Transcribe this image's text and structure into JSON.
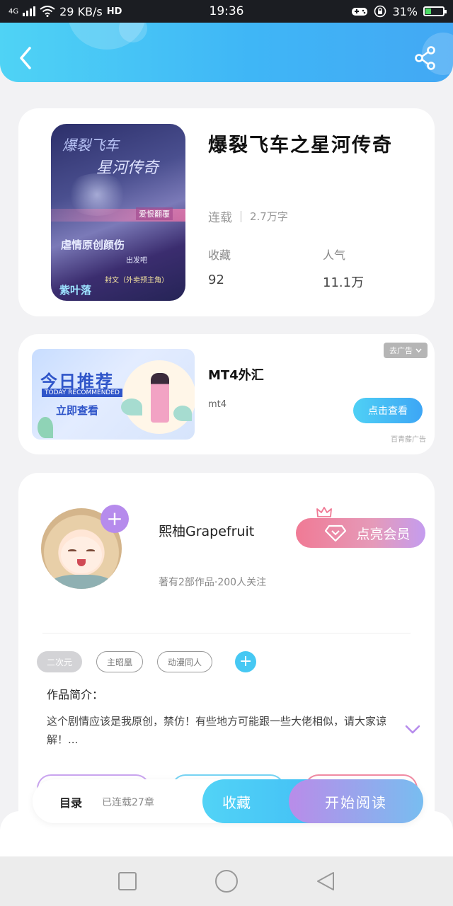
{
  "status_bar": {
    "network": "4G",
    "speed": "29 KB/s",
    "hd": "HD",
    "time": "19:36",
    "battery": "31%"
  },
  "book": {
    "title": "爆裂飞车之星河传奇",
    "status": "连载",
    "words": "2.7万字",
    "favorites_label": "收藏",
    "favorites_value": "92",
    "popularity_label": "人气",
    "popularity_value": "11.1万",
    "cover": {
      "line1": "爆裂飞车",
      "line2": "星河传奇",
      "tag": "爱恨翻覆",
      "line3": "虐情原创颜伤",
      "line4": "出发吧",
      "line5": "封文（外卖预主角）",
      "author_mark": "紫叶落"
    }
  },
  "ad": {
    "image_title": "今日推荐",
    "image_subtitle": "TODAY RECOMMENDED",
    "image_cta": "立即查看",
    "title": "MT4外汇",
    "desc": "mt4",
    "close_label": "去广告",
    "button_label": "点击查看",
    "source": "百青藤广告"
  },
  "author": {
    "name": "熙柚Grapefruit",
    "info": "著有2部作品·200人关注",
    "vip_label": "点亮会员",
    "follow_symbol": "+"
  },
  "tags": [
    {
      "label": "二次元",
      "style": "filled"
    },
    {
      "label": "主昭凰",
      "style": "outline"
    },
    {
      "label": "动漫同人",
      "style": "outline"
    }
  ],
  "tag_add_symbol": "+",
  "intro": {
    "label": "作品简介：",
    "text": "这个剧情应该是我原创，禁仿！有些地方可能跟一些大佬相似，请大家谅解！..."
  },
  "bottom_bar": {
    "toc_label": "目录",
    "toc_status": "已连载27章",
    "collect_label": "收藏",
    "read_label": "开始阅读"
  },
  "colors": {
    "header_start": "#4fd3f5",
    "header_end": "#43a8f4",
    "accent_purple": "#b68bec",
    "vip_pink": "#f07a95",
    "tag_add_blue": "#46c8f3"
  },
  "icons": {
    "back": "chevron-left-icon",
    "share": "share-icon",
    "expand": "chevron-down-icon",
    "crown": "crown-icon",
    "diamond": "diamond-icon",
    "nav_recent": "square-icon",
    "nav_home": "circle-icon",
    "nav_back": "triangle-back-icon"
  }
}
